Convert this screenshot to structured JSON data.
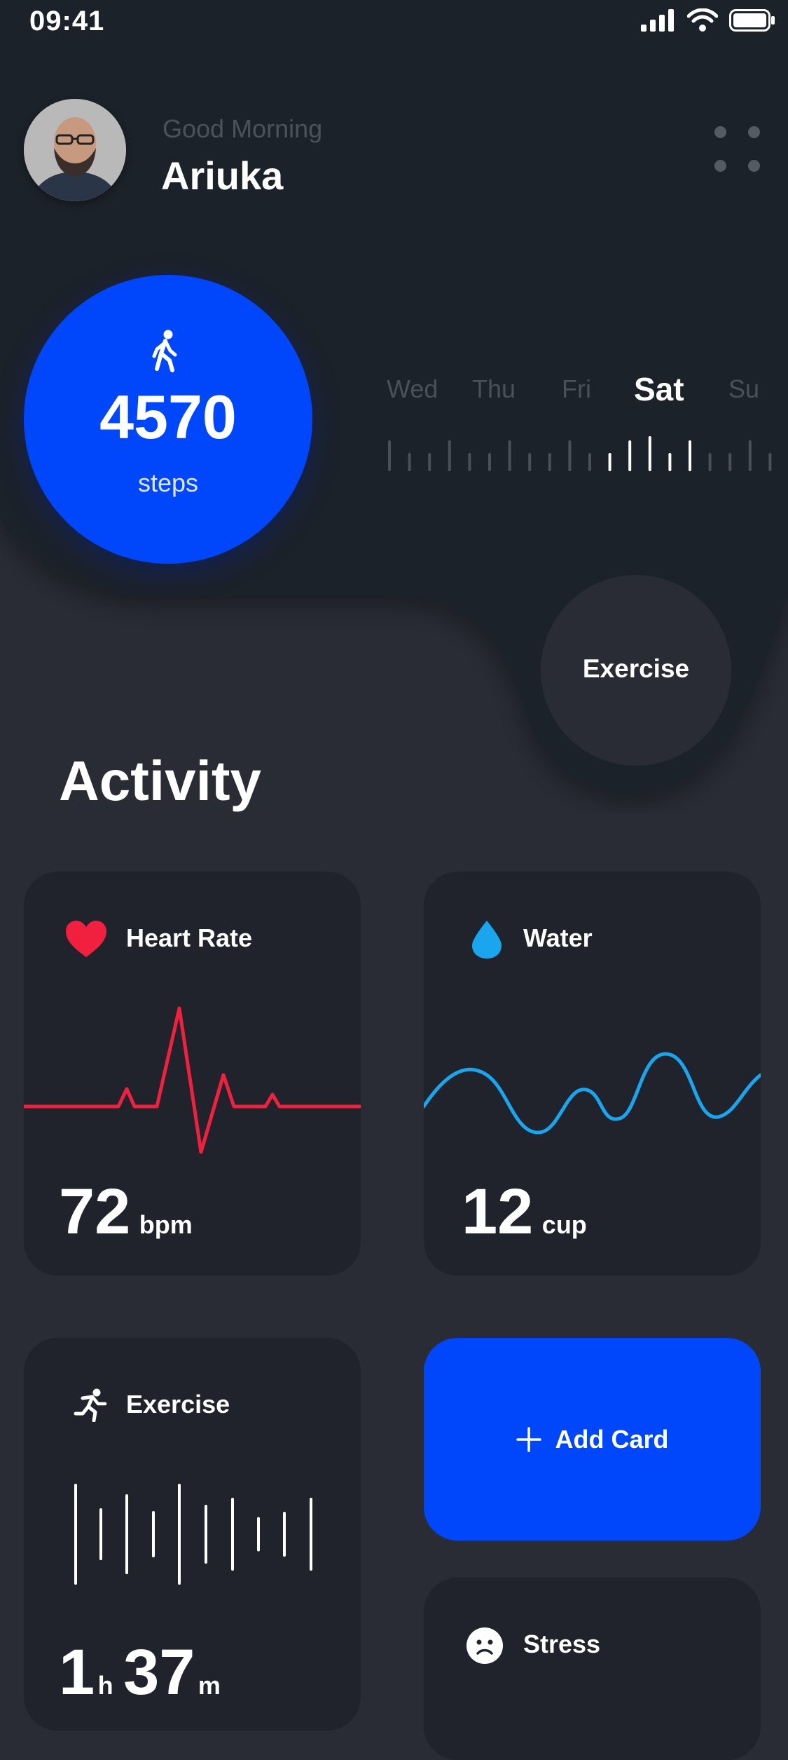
{
  "status_bar": {
    "time": "09:41"
  },
  "header": {
    "greeting": "Good Morning",
    "username": "Ariuka"
  },
  "steps": {
    "value": "4570",
    "label": "steps"
  },
  "days": [
    "Wed",
    "Thu",
    "Fri",
    "Sat",
    "Su"
  ],
  "selected_day": "Sat",
  "exercise_button": {
    "label": "Exercise"
  },
  "activity": {
    "title": "Activity"
  },
  "cards": {
    "heart_rate": {
      "title": "Heart Rate",
      "value": "72",
      "unit": "bpm",
      "color": "#f2203f"
    },
    "water": {
      "title": "Water",
      "value": "12",
      "unit": "cup",
      "color": "#1aa6ee"
    },
    "exercise": {
      "title": "Exercise",
      "hours": "1",
      "hours_unit": "h",
      "minutes": "37",
      "minutes_unit": "m"
    },
    "add_card": {
      "label": "Add Card"
    },
    "stress": {
      "title": "Stress"
    }
  },
  "colors": {
    "accent": "#0047fc",
    "background": "#292c35",
    "card": "#20232b",
    "top_panel": "#1f222a"
  },
  "icons": [
    "walking-icon",
    "heart-icon",
    "water-drop-icon",
    "running-icon",
    "plus-icon",
    "sad-face-icon",
    "signal-icon",
    "wifi-icon",
    "battery-icon",
    "menu-dots-icon"
  ]
}
